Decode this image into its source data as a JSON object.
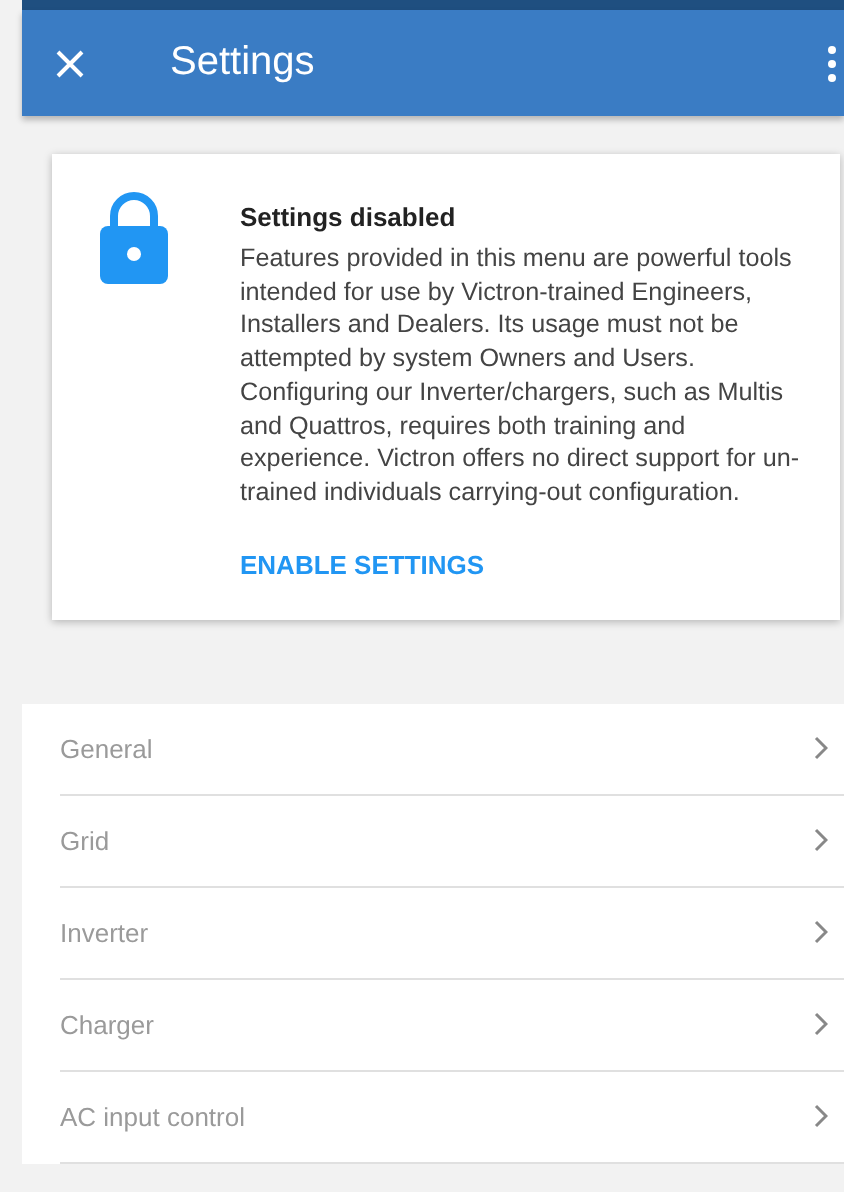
{
  "app_bar": {
    "title": "Settings"
  },
  "notice": {
    "title": "Settings disabled",
    "body": "Features provided in this menu are powerful tools intended for use by Victron-trained Engineers, Installers and Dealers. Its usage must not be attempted by system Owners and Users. Configuring our Inverter/chargers, such as Multis and Quattros, requires both training and experience. Victron offers no direct support for un-trained individuals carrying-out configuration.",
    "action": "ENABLE SETTINGS"
  },
  "menu": [
    {
      "label": "General",
      "disabled": true
    },
    {
      "label": "Grid",
      "disabled": true
    },
    {
      "label": "Inverter",
      "disabled": true
    },
    {
      "label": "Charger",
      "disabled": true
    },
    {
      "label": "AC input control",
      "disabled": true
    }
  ]
}
